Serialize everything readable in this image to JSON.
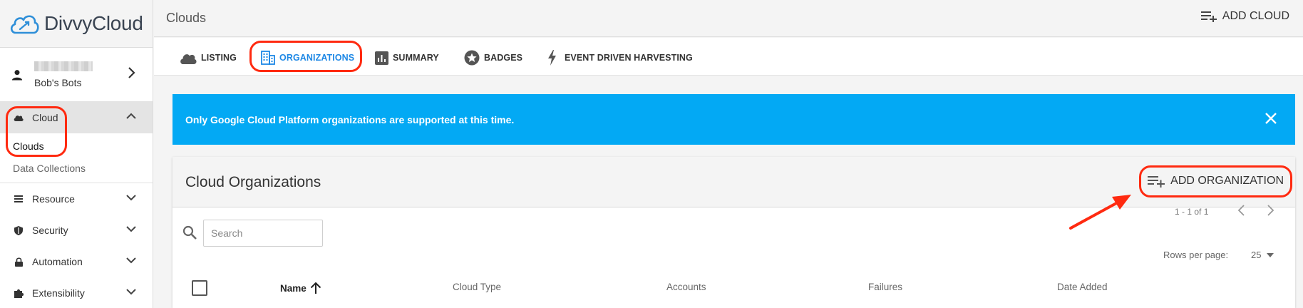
{
  "app": {
    "name": "DivvyCloud"
  },
  "user": {
    "org_name": "Bob's Bots"
  },
  "sidebar": {
    "cloud": {
      "label": "Cloud",
      "items": [
        {
          "label": "Clouds"
        },
        {
          "label": "Data Collections"
        }
      ]
    },
    "groups": [
      {
        "label": "Resource",
        "icon": "list-icon"
      },
      {
        "label": "Security",
        "icon": "shield-icon"
      },
      {
        "label": "Automation",
        "icon": "lock-icon"
      },
      {
        "label": "Extensibility",
        "icon": "puzzle-icon"
      }
    ]
  },
  "header": {
    "title": "Clouds",
    "add_cloud_label": "ADD CLOUD"
  },
  "tabs": [
    {
      "label": "LISTING",
      "icon": "cloud-icon"
    },
    {
      "label": "ORGANIZATIONS",
      "icon": "building-icon",
      "active": true
    },
    {
      "label": "SUMMARY",
      "icon": "bar-chart-icon"
    },
    {
      "label": "BADGES",
      "icon": "star-badge-icon"
    },
    {
      "label": "EVENT DRIVEN HARVESTING",
      "icon": "lightning-icon"
    }
  ],
  "banner": {
    "text": "Only Google Cloud Platform organizations are supported at this time.",
    "color": "#03a9f4"
  },
  "card": {
    "title": "Cloud Organizations",
    "add_label": "ADD ORGANIZATION",
    "search": {
      "placeholder": "Search",
      "value": ""
    },
    "pagination": {
      "range": "1 - 1 of 1",
      "rows_label": "Rows per page:",
      "rows_value": "25"
    },
    "columns": [
      {
        "label": "Name",
        "sorted": "asc"
      },
      {
        "label": "Cloud Type"
      },
      {
        "label": "Accounts"
      },
      {
        "label": "Failures"
      },
      {
        "label": "Date Added"
      }
    ]
  },
  "colors": {
    "accent": "#1e88e5",
    "annotation": "#ff2a10"
  }
}
